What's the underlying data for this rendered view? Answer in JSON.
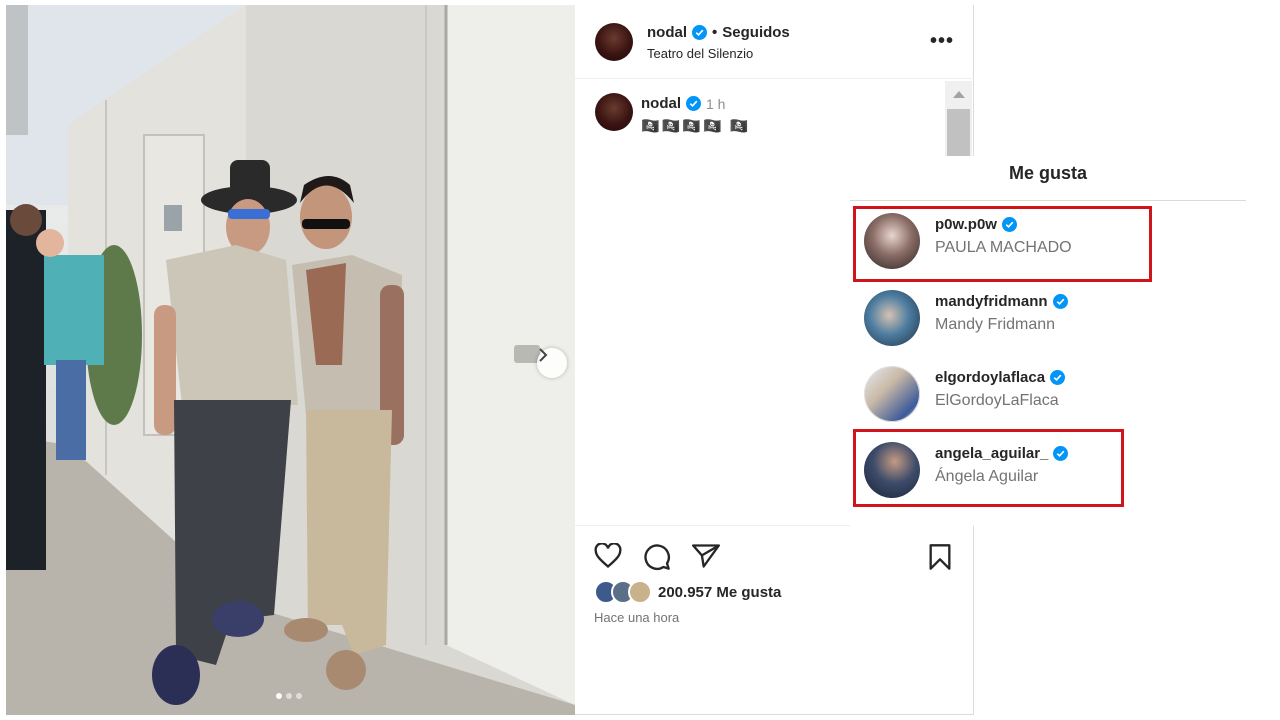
{
  "post": {
    "username": "nodal",
    "separator": "•",
    "follow_status": "Seguidos",
    "location": "Teatro del Silenzio",
    "more_label": "•••",
    "caption": {
      "username": "nodal",
      "time": "1 h",
      "text": "🏴‍☠️🏴‍☠️🏴‍☠️🏴‍☠️ 🏴‍☠️"
    },
    "likes_count": "200.957 Me gusta",
    "time_ago": "Hace una hora",
    "carousel": {
      "slides": 3,
      "active_index": 0
    }
  },
  "likes_dialog": {
    "title": "Me gusta",
    "users": [
      {
        "username": "p0w.p0w",
        "full_name": "PAULA MACHADO",
        "verified": true,
        "highlighted": true
      },
      {
        "username": "mandyfridmann",
        "full_name": "Mandy Fridmann",
        "verified": true,
        "highlighted": false
      },
      {
        "username": "elgordoylaflaca",
        "full_name": "ElGordoyLaFlaca",
        "verified": true,
        "highlighted": false
      },
      {
        "username": "angela_aguilar_",
        "full_name": "Ángela Aguilar",
        "verified": true,
        "highlighted": true
      }
    ]
  },
  "colors": {
    "verified": "#0095f6",
    "highlight_border": "#d0141c",
    "text_primary": "#262626",
    "text_secondary": "#737373"
  },
  "icons": [
    "verified-badge-icon",
    "more-icon",
    "heart-icon",
    "comment-icon",
    "share-icon",
    "bookmark-icon",
    "chevron-right-icon",
    "scroll-up-icon"
  ]
}
